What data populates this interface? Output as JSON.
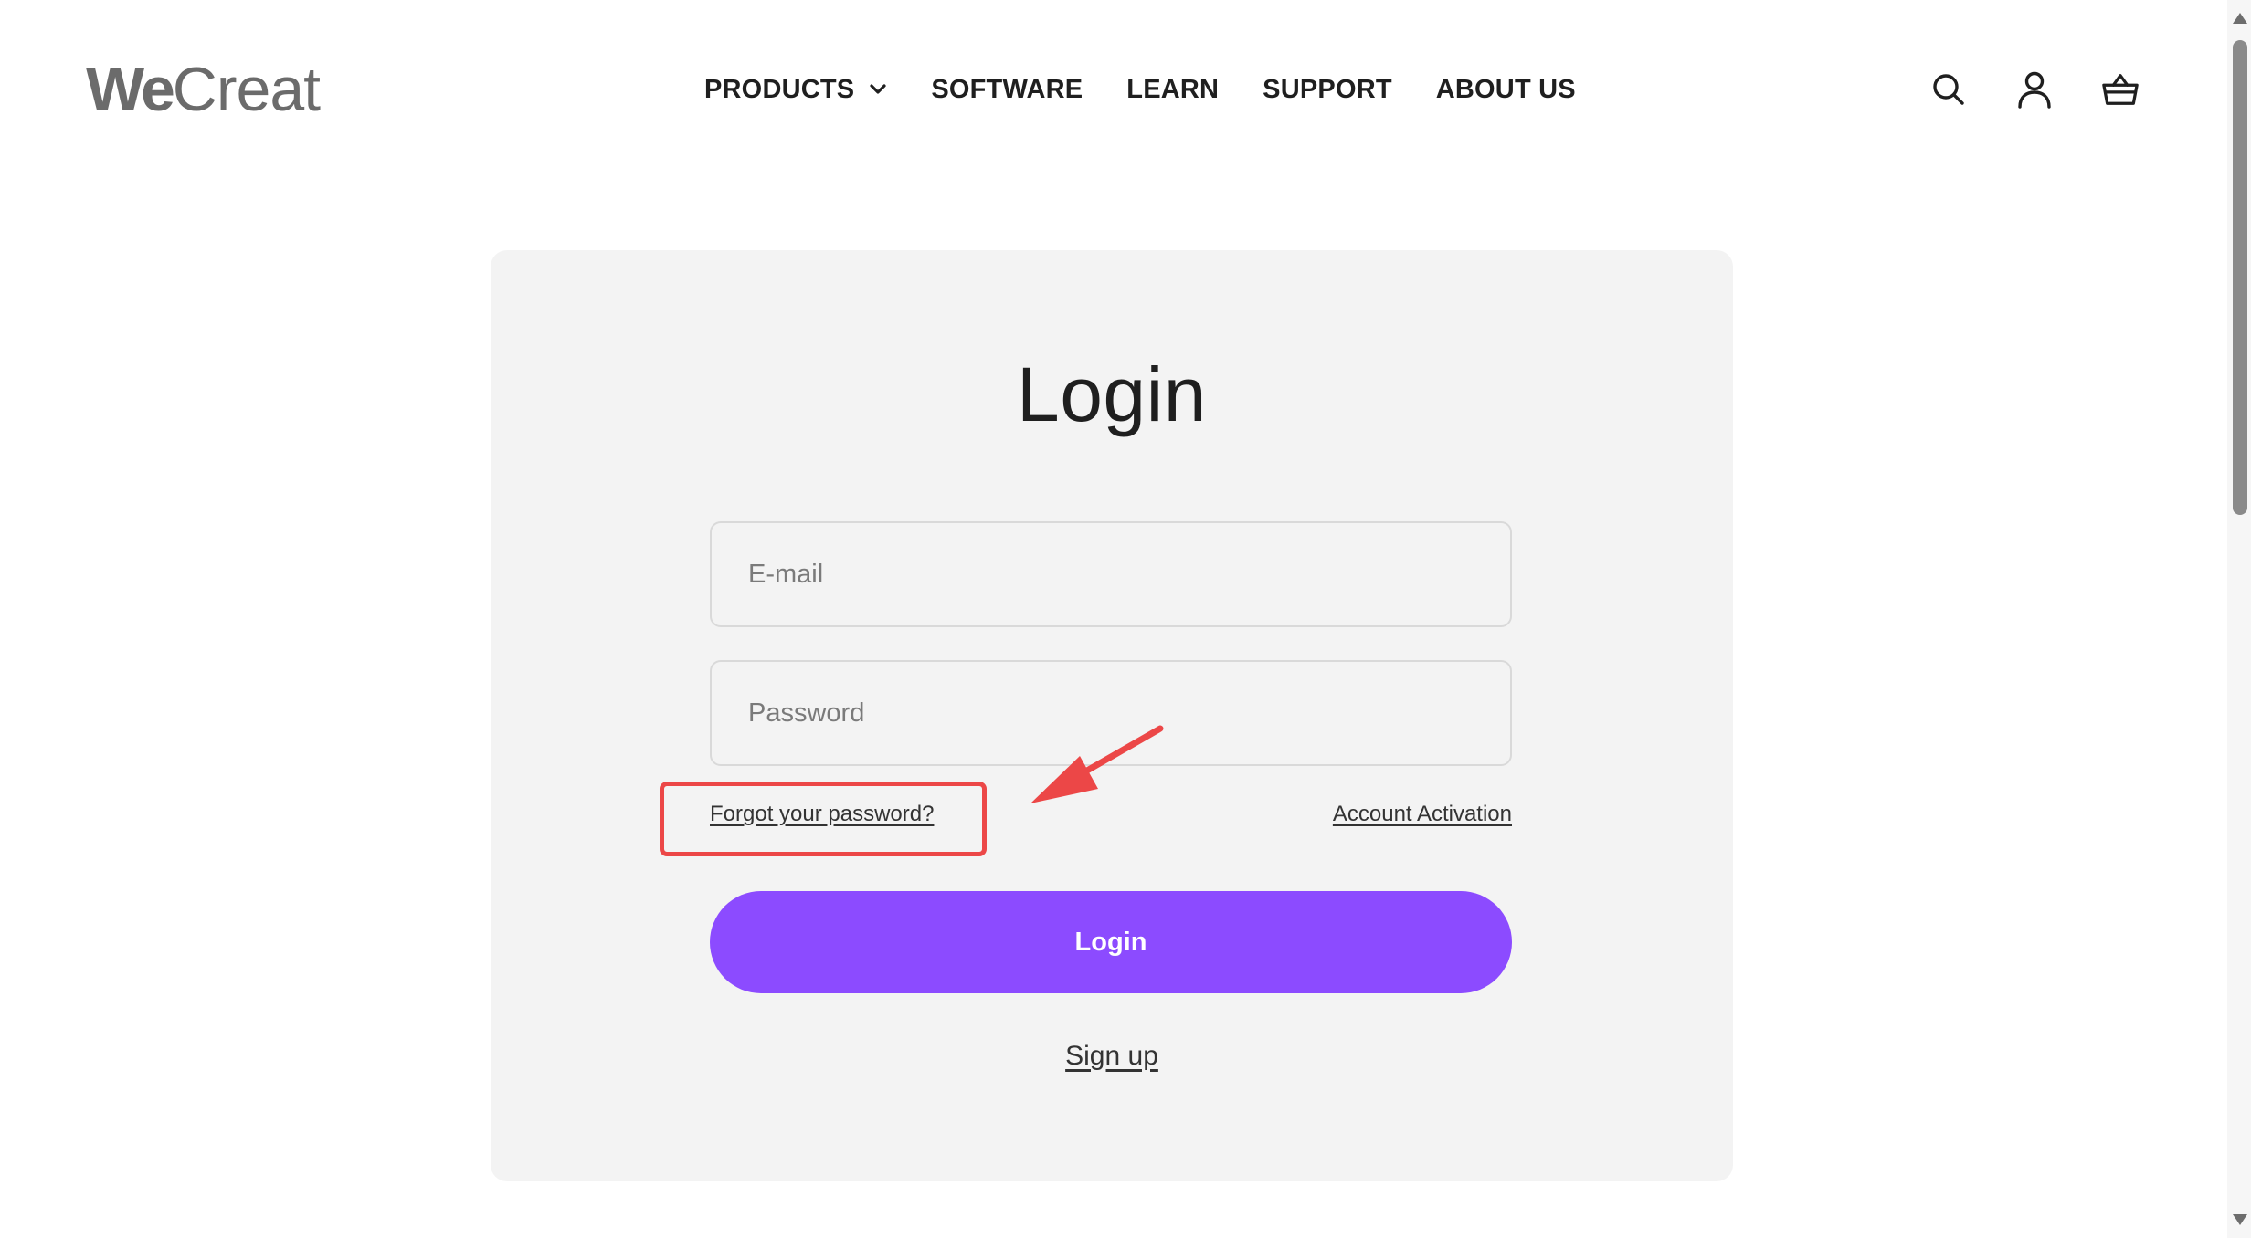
{
  "header": {
    "logo": {
      "bold_part": "We",
      "light_part": "Creat"
    },
    "nav": [
      {
        "label": "PRODUCTS",
        "has_dropdown": true
      },
      {
        "label": "SOFTWARE"
      },
      {
        "label": "LEARN"
      },
      {
        "label": "SUPPORT"
      },
      {
        "label": "ABOUT US"
      }
    ],
    "icons": [
      "search-icon",
      "account-icon",
      "cart-icon"
    ]
  },
  "login": {
    "title": "Login",
    "email_placeholder": "E-mail",
    "password_placeholder": "Password",
    "forgot_link": "Forgot your password?",
    "activation_link": "Account Activation",
    "submit_label": "Login",
    "signup_link": "Sign up"
  },
  "colors": {
    "accent": "#8c4bff",
    "card_bg": "#f3f3f3",
    "annotation": "#ec4747"
  }
}
